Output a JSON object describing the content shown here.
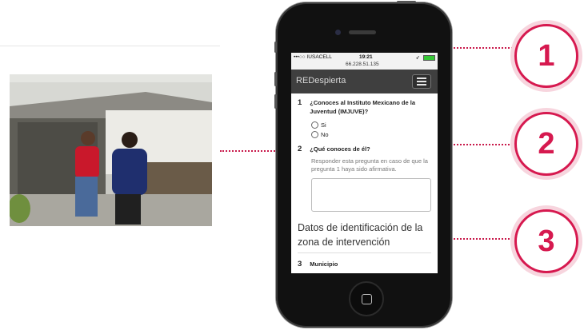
{
  "status_bar": {
    "carrier": "•••○○ IUSACELL",
    "time": "19:21",
    "ip": "66.228.51.135",
    "location_glyph": "➶"
  },
  "app": {
    "brand": "REDespierta"
  },
  "questions": [
    {
      "number": "1",
      "text": "¿Conoces al Instituto Mexicano de la Juventud (IMJUVE)?",
      "options": [
        "Si",
        "No"
      ]
    },
    {
      "number": "2",
      "text": "¿Qué conoces de él?",
      "help": "Responder esta pregunta en caso de que la pregunta 1 haya sido afirmativa."
    },
    {
      "number": "3",
      "text": "Municipio"
    }
  ],
  "section_title": "Datos de identificación de la zona de intervención",
  "callouts": [
    "1",
    "2",
    "3"
  ],
  "colors": {
    "accent": "#d6194f",
    "appbar": "#3f3f3f"
  }
}
